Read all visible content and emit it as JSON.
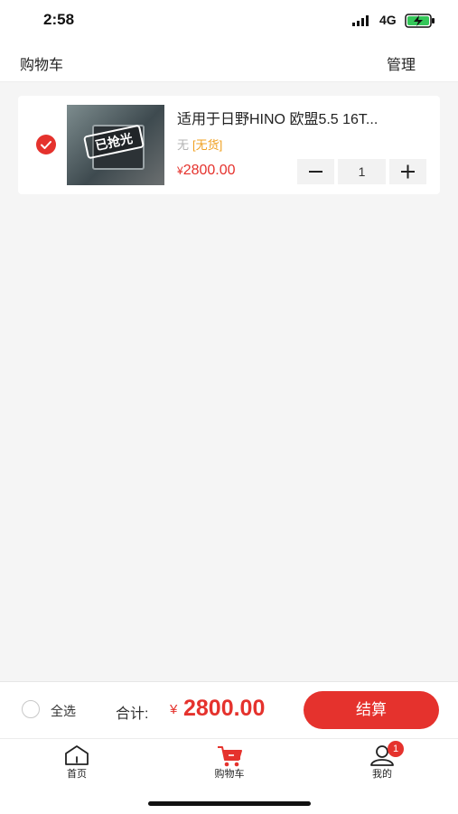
{
  "status_bar": {
    "time": "2:58",
    "network": "4G"
  },
  "header": {
    "title": "购物车",
    "manage_label": "管理"
  },
  "cart_items": [
    {
      "checked": true,
      "title": "适用于日野HINO 欧盟5.5 16T...",
      "image_overlay": "已抢光",
      "spec": "无",
      "stock_status": "[无货]",
      "currency": "¥",
      "price": "2800.00",
      "quantity": "1",
      "minus_icon": "minus-icon",
      "plus_icon": "plus-icon"
    }
  ],
  "footer": {
    "select_all_label": "全选",
    "total_label": "合计:",
    "currency": "¥",
    "total_value": "2800.00",
    "checkout_label": "结算"
  },
  "tabs": [
    {
      "label": "首页",
      "icon": "home-icon"
    },
    {
      "label": "购物车",
      "icon": "cart-icon",
      "active": true
    },
    {
      "label": "我的",
      "icon": "user-icon",
      "badge": "1"
    }
  ],
  "colors": {
    "accent": "#e5322d",
    "stock_warning": "#f0a020",
    "background": "#f5f5f5"
  }
}
